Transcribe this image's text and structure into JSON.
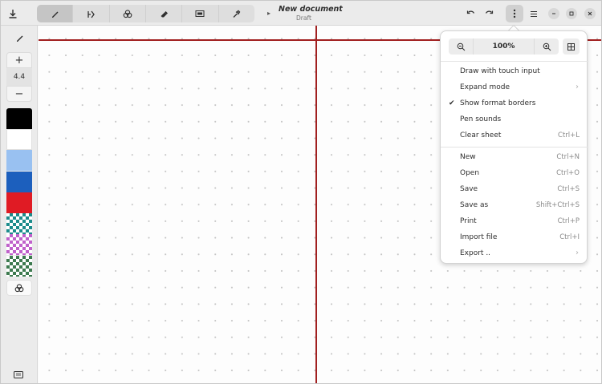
{
  "header": {
    "title": "New document",
    "subtitle": "Draft"
  },
  "tools": [
    {
      "name": "pen",
      "icon": "pencil-icon",
      "active": true
    },
    {
      "name": "shapes",
      "icon": "shapes-icon",
      "active": false
    },
    {
      "name": "fill",
      "icon": "fill-icon",
      "active": false
    },
    {
      "name": "eraser",
      "icon": "eraser-icon",
      "active": false
    },
    {
      "name": "selection",
      "icon": "selection-icon",
      "active": false
    },
    {
      "name": "tools",
      "icon": "tools-icon",
      "active": false
    }
  ],
  "sidebar": {
    "pen_size": "4.4",
    "plus": "+",
    "minus": "−",
    "swatches": [
      "#000000",
      "#ffffff",
      "#99c1f1",
      "#1c5fbd",
      "#e01b24",
      "checker-teal",
      "checker-pink",
      "checker-green"
    ]
  },
  "menu": {
    "zoom_level": "100%",
    "items_top": [
      {
        "label": "Draw with touch input",
        "accel": "",
        "check": false,
        "submenu": false
      },
      {
        "label": "Expand mode",
        "accel": "",
        "check": false,
        "submenu": true
      },
      {
        "label": "Show format borders",
        "accel": "",
        "check": true,
        "submenu": false
      },
      {
        "label": "Pen sounds",
        "accel": "",
        "check": false,
        "submenu": false
      },
      {
        "label": "Clear sheet",
        "accel": "Ctrl+L",
        "check": false,
        "submenu": false
      }
    ],
    "items_bottom": [
      {
        "label": "New",
        "accel": "Ctrl+N",
        "check": false,
        "submenu": false
      },
      {
        "label": "Open",
        "accel": "Ctrl+O",
        "check": false,
        "submenu": false
      },
      {
        "label": "Save",
        "accel": "Ctrl+S",
        "check": false,
        "submenu": false
      },
      {
        "label": "Save as",
        "accel": "Shift+Ctrl+S",
        "check": false,
        "submenu": false
      },
      {
        "label": "Print",
        "accel": "Ctrl+P",
        "check": false,
        "submenu": false
      },
      {
        "label": "Import file",
        "accel": "Ctrl+I",
        "check": false,
        "submenu": false
      },
      {
        "label": "Export ..",
        "accel": "",
        "check": false,
        "submenu": true
      }
    ]
  },
  "colors": {
    "format_border": "#a12020",
    "accent_bg": "#ebebeb"
  }
}
